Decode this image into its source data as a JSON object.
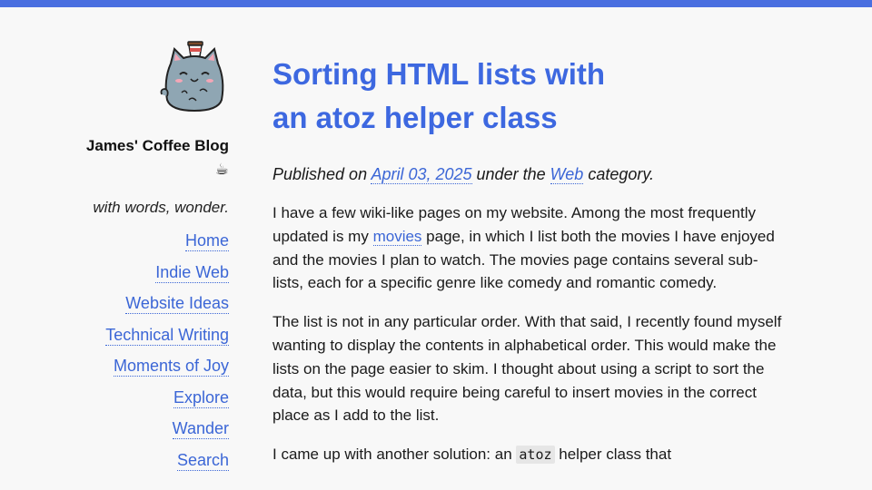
{
  "site": {
    "title": "James' Coffee Blog ☕",
    "tagline": "with words, wonder.",
    "logo_icon": "cat-with-coffee-cup-icon"
  },
  "nav": {
    "items": [
      {
        "label": "Home"
      },
      {
        "label": "Indie Web"
      },
      {
        "label": "Website Ideas"
      },
      {
        "label": "Technical Writing"
      },
      {
        "label": "Moments of Joy"
      },
      {
        "label": "Explore"
      },
      {
        "label": "Wander"
      },
      {
        "label": "Search"
      }
    ]
  },
  "article": {
    "title": "Sorting HTML lists with an atoz helper class",
    "meta": {
      "prefix": "Published on",
      "date": "April 03, 2025",
      "middle": "under the",
      "category": "Web",
      "suffix": "category."
    },
    "p1": {
      "a": "I have a few wiki-like pages on my website. Among the most frequently updated is my",
      "link": "movies",
      "b": "page, in which I list both the movies I have enjoyed and the movies I plan to watch. The movies page contains several sub-lists, each for a specific genre like comedy and romantic comedy."
    },
    "p2": "The list is not in any particular order. With that said, I recently found myself wanting to display the contents in alphabetical order. This would make the lists on the page easier to skim. I thought about using a script to sort the data, but this would require being careful to insert movies in the correct place as I add to the list.",
    "p3": {
      "a": "I came up with another solution: an",
      "code": "atoz",
      "b": "helper class that"
    }
  },
  "colors": {
    "accent": "#4a6fe0",
    "link": "#3b66d6",
    "background": "#f8f8f8"
  }
}
